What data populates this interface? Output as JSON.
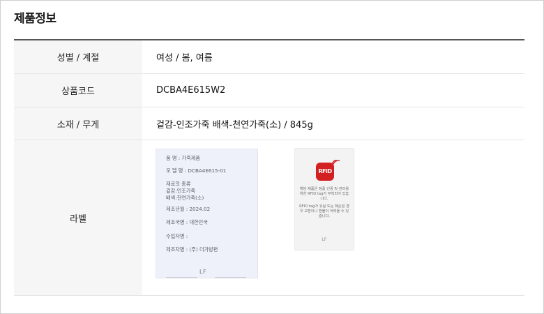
{
  "section_title": "제품정보",
  "rows": [
    {
      "label": "성별 / 계절",
      "value": "여성 / 봄, 여름"
    },
    {
      "label": "상품코드",
      "value": "DCBA4E615W2"
    },
    {
      "label": "소재 / 무게",
      "value": "겉감-인조가죽 배색-천연가죽(소) / 845g"
    },
    {
      "label": "라벨"
    }
  ],
  "label_tag": {
    "item_name": "품    명 : 가죽제품",
    "model_name": "모 델 명 : DCBA4E615-01",
    "material_title": "재료의 종류",
    "material_outer": "겉감:인조가죽",
    "material_accent": "배색:천연가죽(소)",
    "manufactured_date": "제조년월 : 2024.02",
    "country": "제조국명 : 대한민국",
    "importer": "수입자명 :",
    "manufacturer": "제조자명 : (주) 더가방편",
    "logo": "LF"
  },
  "rfid_card": {
    "badge_text": "RFID",
    "notice_1": "해당 제품은 정품 인증 및 관리를 위한 RFID tag가 부착되어 있습니다.",
    "notice_2": "RFID tag가 유실 또는 훼손된 경우 교환이나 환불이 어려울 수 있습니다.",
    "logo": "LF",
    "badge_color": "#d32020"
  }
}
